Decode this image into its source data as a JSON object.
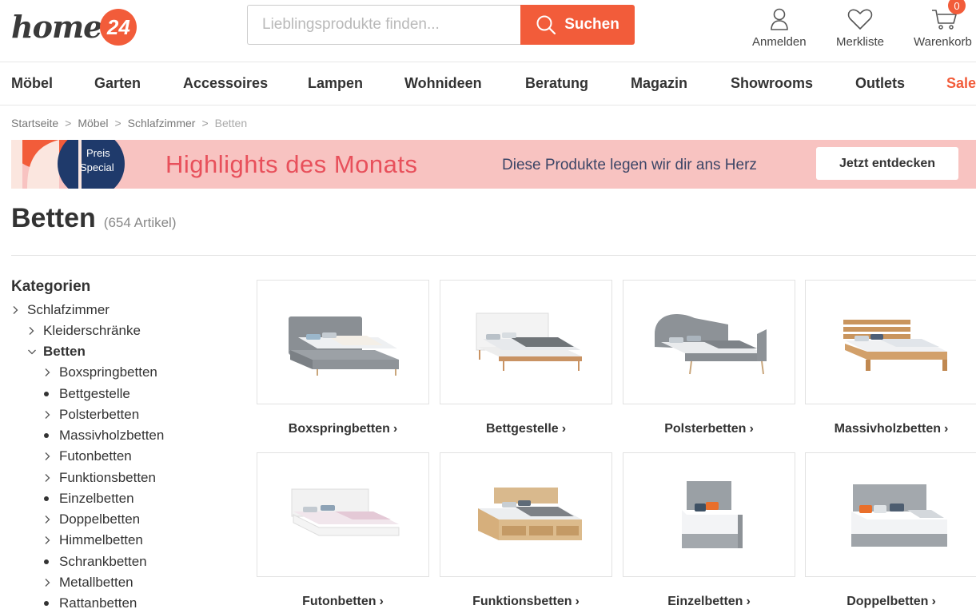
{
  "brand": {
    "logo_text": "home",
    "logo_badge": "24"
  },
  "search": {
    "placeholder": "Lieblingsprodukte finden...",
    "button_label": "Suchen"
  },
  "header_actions": {
    "login": "Anmelden",
    "wishlist": "Merkliste",
    "cart": "Warenkorb",
    "cart_count": "0"
  },
  "nav": [
    "Möbel",
    "Garten",
    "Accessoires",
    "Lampen",
    "Wohnideen",
    "Beratung",
    "Magazin",
    "Showrooms",
    "Outlets",
    "Sale"
  ],
  "breadcrumb": [
    "Startseite",
    "Möbel",
    "Schlafzimmer",
    "Betten"
  ],
  "breadcrumb_separator": ">",
  "banner": {
    "badge_line1": "Preis",
    "badge_line2": "Special",
    "title": "Highlights des Monats",
    "subtitle": "Diese Produkte legen wir dir ans Herz",
    "button": "Jetzt entdecken"
  },
  "page": {
    "title": "Betten",
    "count": "(654 Artikel)"
  },
  "sidebar": {
    "title": "Kategorien",
    "items": [
      {
        "label": "Schlafzimmer",
        "marker": "chevron-right"
      },
      {
        "label": "Kleiderschränke",
        "marker": "chevron-right"
      },
      {
        "label": "Betten",
        "marker": "chevron-down",
        "active": true
      },
      {
        "label": "Boxspringbetten",
        "marker": "chevron-right"
      },
      {
        "label": "Bettgestelle",
        "marker": "bullet"
      },
      {
        "label": "Polsterbetten",
        "marker": "chevron-right"
      },
      {
        "label": "Massivholzbetten",
        "marker": "bullet"
      },
      {
        "label": "Futonbetten",
        "marker": "chevron-right"
      },
      {
        "label": "Funktionsbetten",
        "marker": "chevron-right"
      },
      {
        "label": "Einzelbetten",
        "marker": "bullet"
      },
      {
        "label": "Doppelbetten",
        "marker": "chevron-right"
      },
      {
        "label": "Himmelbetten",
        "marker": "chevron-right"
      },
      {
        "label": "Schrankbetten",
        "marker": "bullet"
      },
      {
        "label": "Metallbetten",
        "marker": "chevron-right"
      },
      {
        "label": "Rattanbetten",
        "marker": "bullet"
      }
    ]
  },
  "categories": [
    {
      "label": "Boxspringbetten",
      "image": "grey-boxspring-bed"
    },
    {
      "label": "Bettgestelle",
      "image": "white-bed-frame"
    },
    {
      "label": "Polsterbetten",
      "image": "grey-upholstered-bed"
    },
    {
      "label": "Massivholzbetten",
      "image": "solid-wood-bed"
    },
    {
      "label": "Futonbetten",
      "image": "white-futon-bed"
    },
    {
      "label": "Funktionsbetten",
      "image": "wood-storage-bed"
    },
    {
      "label": "Einzelbetten",
      "image": "grey-single-bed"
    },
    {
      "label": "Doppelbetten",
      "image": "grey-double-bed"
    }
  ],
  "colors": {
    "accent": "#f25c3a",
    "banner_bg": "#f8c3c1",
    "banner_title": "#e8505b",
    "banner_sub": "#3b4566"
  }
}
